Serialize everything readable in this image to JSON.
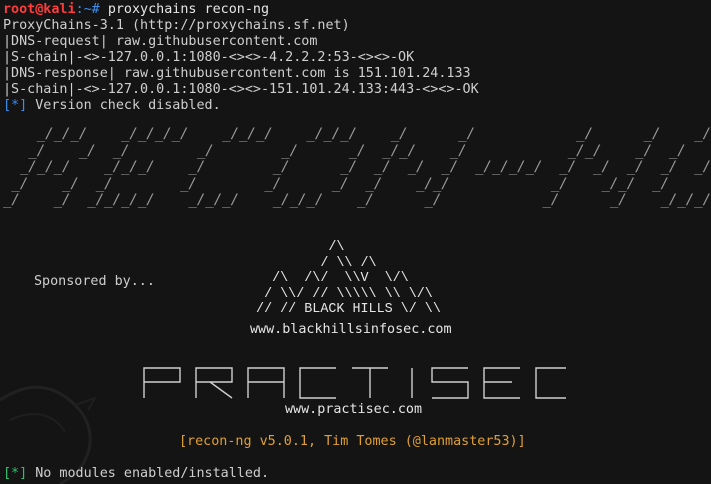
{
  "prompt": {
    "user_host": "root@kali",
    "path_suffix": ":~# ",
    "command": "proxychains recon-ng"
  },
  "proxychains": {
    "version": "ProxyChains-3.1 (http://proxychains.sf.net)",
    "lines": [
      "|DNS-request| raw.githubusercontent.com",
      "|S-chain|-<>-127.0.0.1:1080-<><>-4.2.2.2:53-<><>-OK",
      "|DNS-response| raw.githubusercontent.com is 151.101.24.133",
      "|S-chain|-<>-127.0.0.1:1080-<><>-151.101.24.133:443-<><>-OK"
    ]
  },
  "status": {
    "prefix": "[*]",
    "version_check": " Version check disabled.",
    "modules": " No modules enabled/installed."
  },
  "banner": {
    "ascii": "    _/_/_/    _/_/_/_/    _/_/_/    _/_/_/    _/      _/            _/      _/    _/_/_/\n   _/    _/  _/        _/        _/      _/  _/_/    _/            _/_/    _/  _/\n  _/_/_/    _/_/_/    _/        _/      _/  _/  _/  _/  _/_/_/_/  _/  _/  _/  _/  _/_/_/\n _/    _/  _/        _/        _/      _/  _/    _/_/            _/    _/_/  _/      _/\n_/    _/  _/_/_/_/    _/_/_/    _/_/_/    _/      _/            _/      _/    _/_/_/"
  },
  "sponsor": {
    "label": "Sponsored by...",
    "art": "          /\\\n         / \\\\ /\\\n   /\\  /\\/  \\\\V  \\/\\\n  / \\\\/ // \\\\\\\\\\ \\\\ \\/\\\n // // BLACK HILLS \\/ \\\\",
    "url": "www.blackhillsinfosec.com"
  },
  "practisec": {
    "letters": [
      "P",
      "R",
      "A",
      "C",
      "T",
      "I",
      "S",
      "E",
      "C"
    ],
    "url": "www.practisec.com"
  },
  "version_banner": "[recon-ng v5.0.1, Tim Tomes (@lanmaster53)]",
  "colors": {
    "background": "#141414",
    "prompt_red": "#ff3b3b",
    "path_blue": "#3b8eea",
    "status_green": "#2fbf71",
    "version_orange": "#e0a030"
  }
}
